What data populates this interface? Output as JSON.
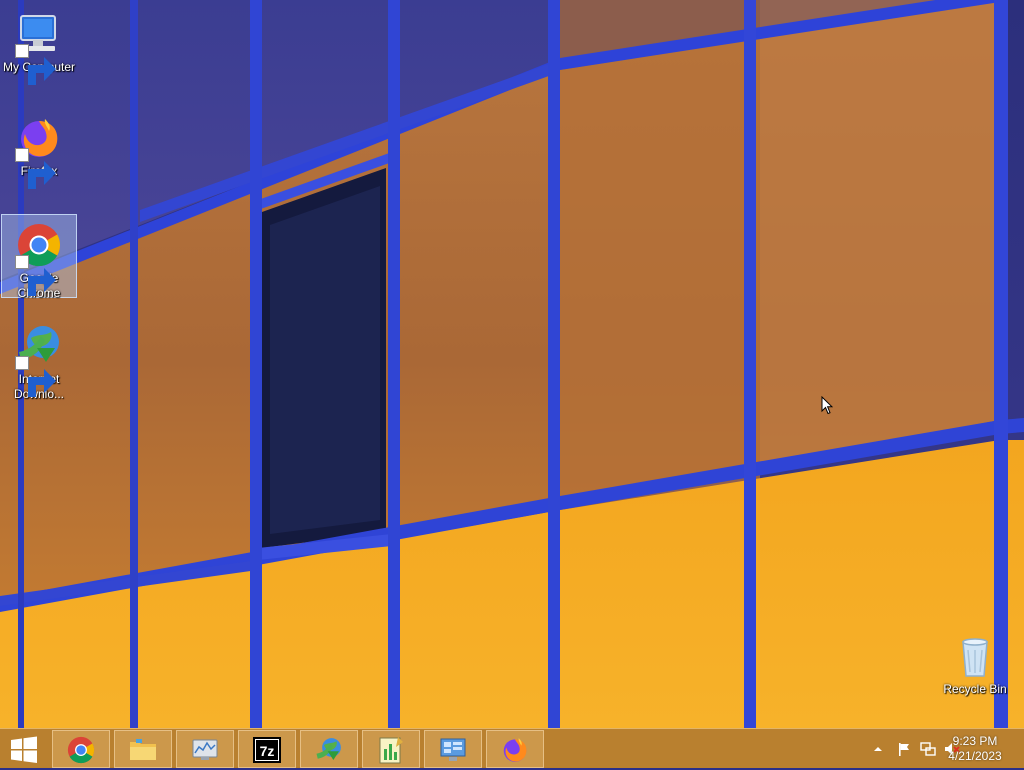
{
  "desktop": {
    "icons": [
      {
        "label": "My Computer",
        "icon": "computer-icon"
      },
      {
        "label": "Firefox",
        "icon": "firefox-icon"
      },
      {
        "label": "Google Chrome",
        "icon": "chrome-icon",
        "selected": true
      },
      {
        "label": "Internet Downlo...",
        "icon": "internet-download-manager-icon"
      },
      {
        "label": "Recycle Bin",
        "icon": "recycle-bin-icon"
      }
    ]
  },
  "taskbar": {
    "start": {
      "icon": "windows-logo-icon"
    },
    "pinned": [
      {
        "name": "Google Chrome",
        "icon": "chrome-icon"
      },
      {
        "name": "File Explorer",
        "icon": "folder-icon"
      },
      {
        "name": "Resource Monitor",
        "icon": "monitor-icon"
      },
      {
        "name": "7-Zip",
        "icon": "7zip-icon",
        "text": "7z"
      },
      {
        "name": "Internet Download Manager",
        "icon": "idm-icon"
      },
      {
        "name": "Task Manager",
        "icon": "chart-notepad-icon"
      },
      {
        "name": "Control Panel",
        "icon": "control-panel-icon"
      },
      {
        "name": "Firefox",
        "icon": "firefox-icon"
      }
    ],
    "tray": {
      "icons": [
        "show-hidden-icons-icon",
        "action-center-flag-icon",
        "network-icon",
        "volume-muted-icon"
      ],
      "time": "9:23 PM",
      "date": "4/21/2023"
    }
  },
  "colors": {
    "frame_blue": "#2d3fd0",
    "glass_amber": "#f0a020",
    "taskbar": "#c48628"
  }
}
